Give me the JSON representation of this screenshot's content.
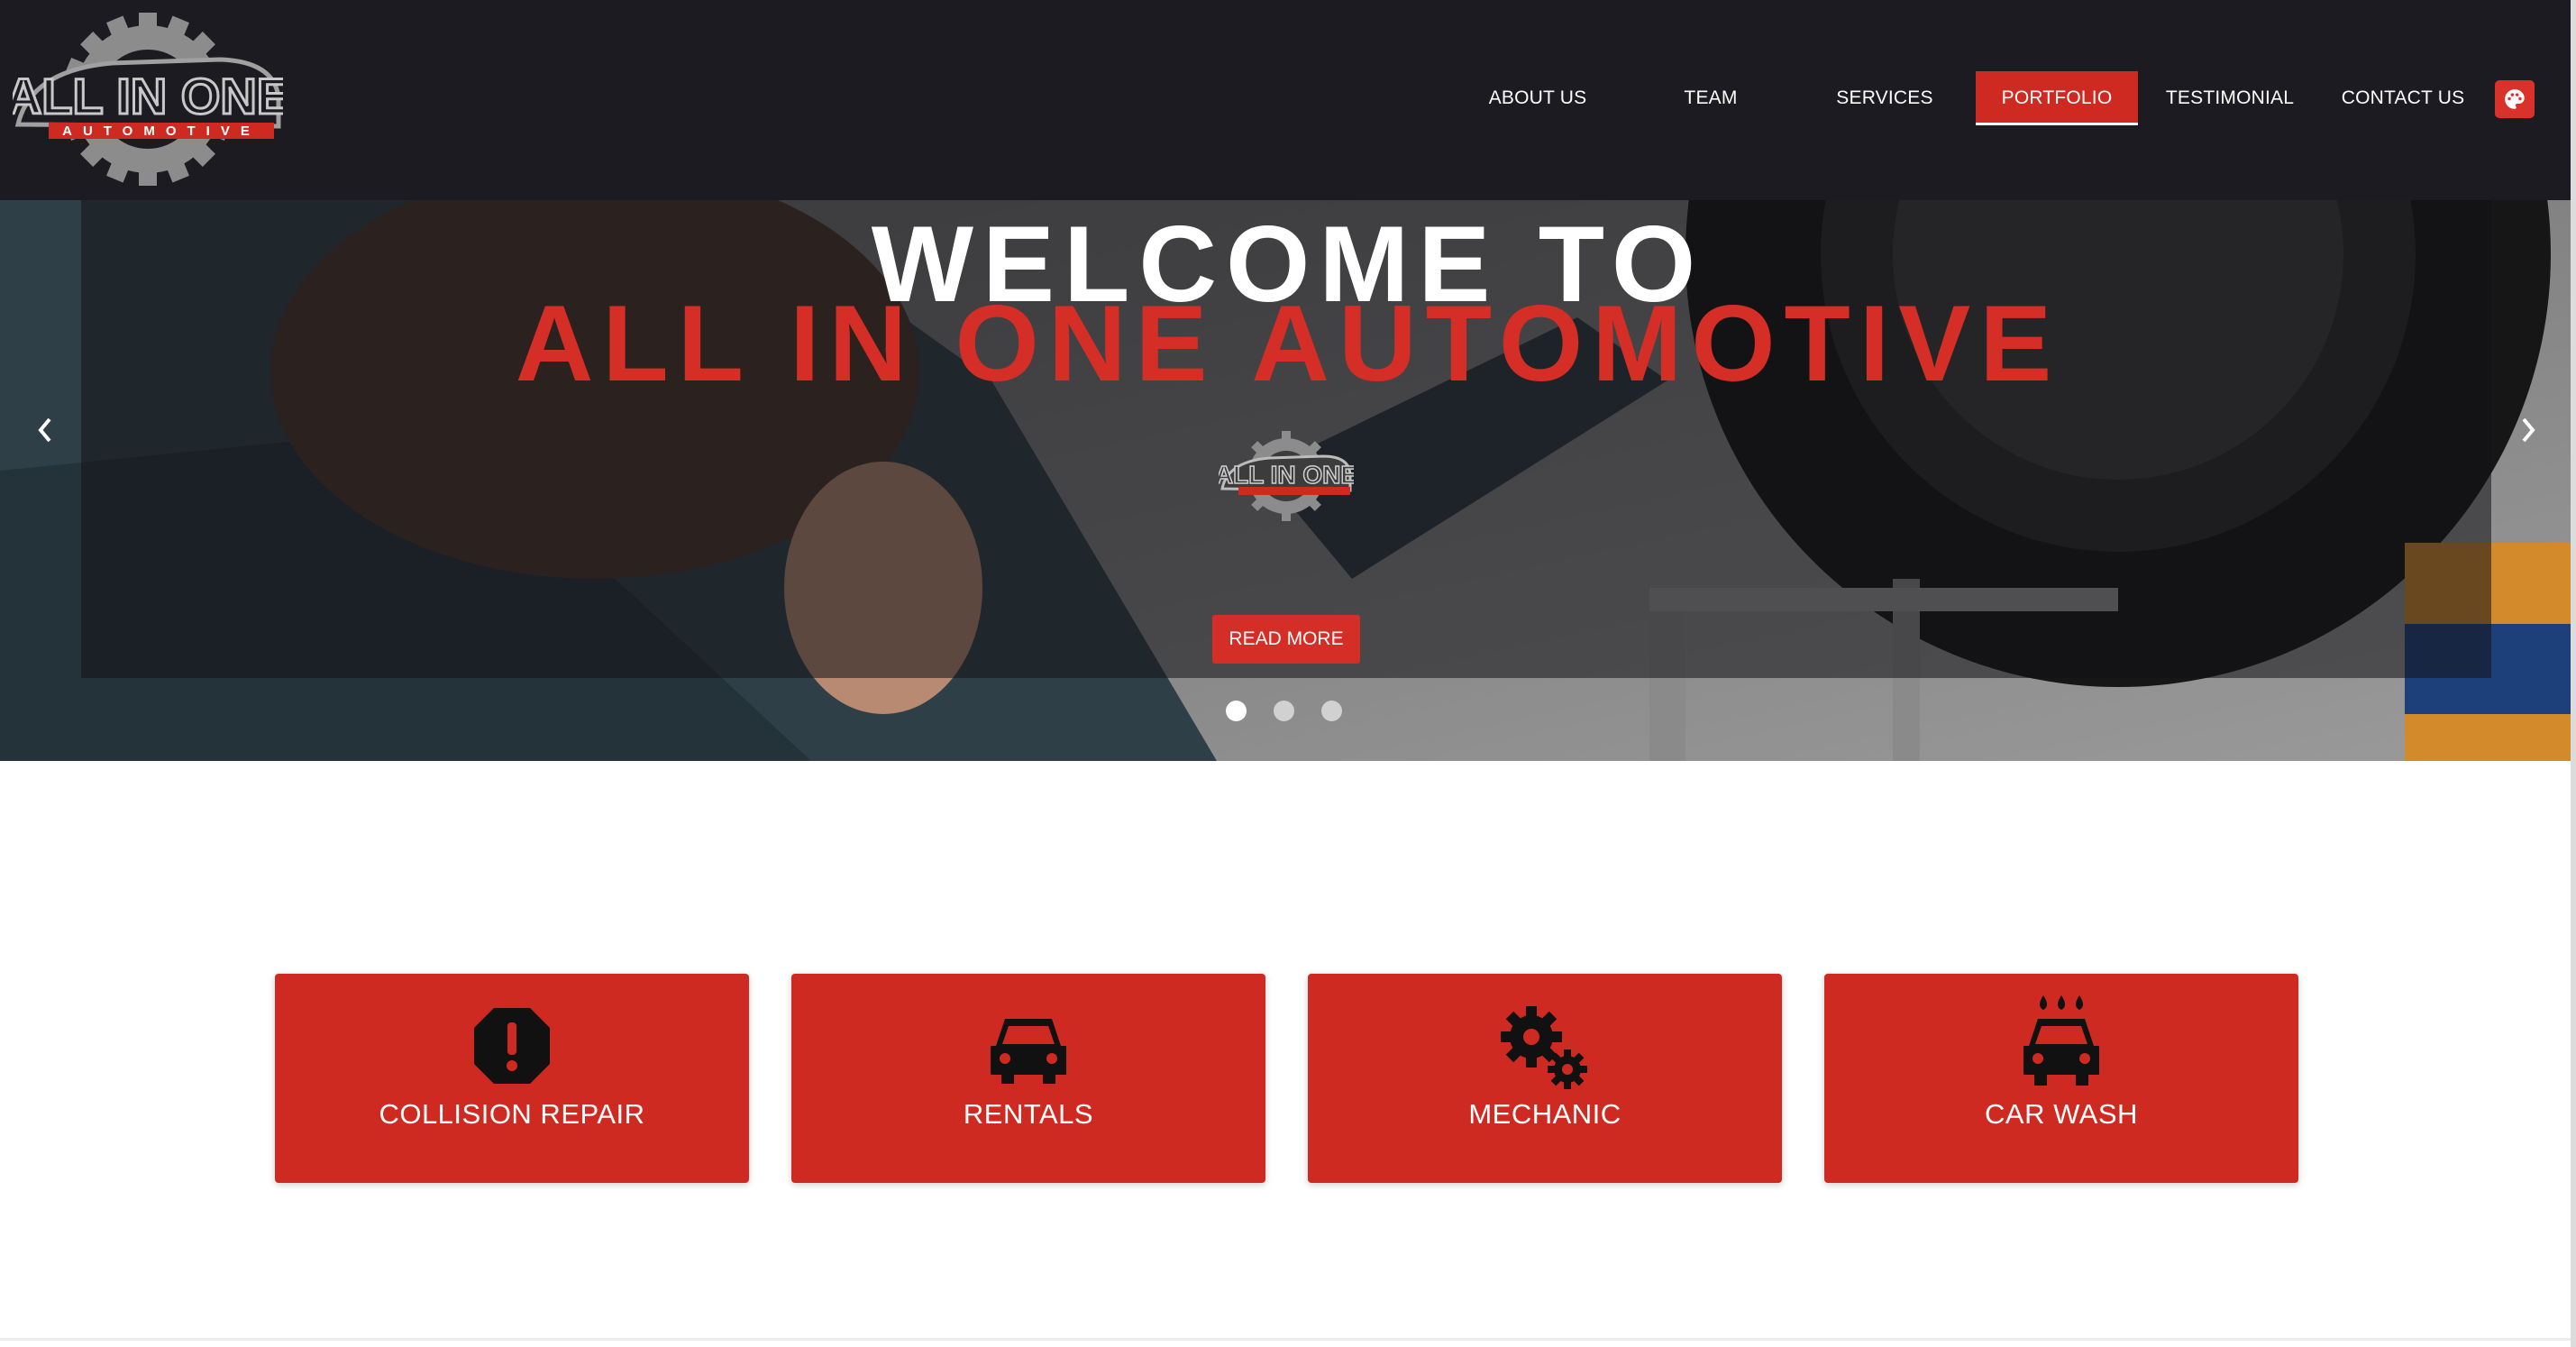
{
  "nav": {
    "items": [
      {
        "label": "ABOUT US"
      },
      {
        "label": "TEAM"
      },
      {
        "label": "SERVICES"
      },
      {
        "label": "PORTFOLIO"
      },
      {
        "label": "TESTIMONIAL"
      },
      {
        "label": "CONTACT US"
      }
    ],
    "active_label": "PORTFOLIO",
    "palette_icon": "palette-icon"
  },
  "logo": {
    "text_main": "ALL IN ONE",
    "text_sub": "AUTOMOTIVE"
  },
  "hero": {
    "title_line1": "WELCOME TO",
    "title_line2": "ALL IN ONE AUTOMOTIVE",
    "button_label": "READ MORE",
    "slide_count": 3,
    "active_slide": 1
  },
  "services": [
    {
      "label": "COLLISION REPAIR",
      "icon": "alert-octagon-icon"
    },
    {
      "label": "RENTALS",
      "icon": "car-icon"
    },
    {
      "label": "MECHANIC",
      "icon": "gears-icon"
    },
    {
      "label": "CAR WASH",
      "icon": "car-wash-icon"
    }
  ],
  "colors": {
    "header_bg": "#1c1b21",
    "accent": "#cf2a21",
    "text_light": "#ffffff"
  }
}
